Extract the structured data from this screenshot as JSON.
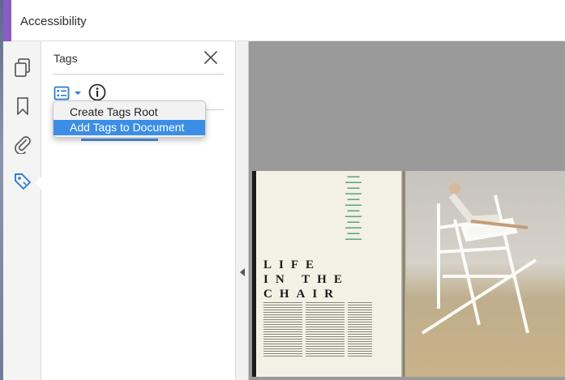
{
  "header": {
    "title": "Accessibility",
    "accent_color": "#8a5cc7"
  },
  "rail": {
    "icons": [
      "pages-icon",
      "bookmark-icon",
      "attachment-icon",
      "tag-icon"
    ],
    "active": "tag-icon"
  },
  "tags_panel": {
    "title": "Tags",
    "options_icon": "tag-options-icon",
    "info_icon": "info-icon"
  },
  "menu": {
    "items": [
      {
        "label": "Create Tags Root",
        "highlighted": false
      },
      {
        "label": "Add Tags to Document",
        "highlighted": true
      }
    ],
    "highlight_color": "#3b8de6"
  },
  "document": {
    "headline_lines": [
      "LIFE",
      "IN THE",
      "CHAIR"
    ]
  }
}
